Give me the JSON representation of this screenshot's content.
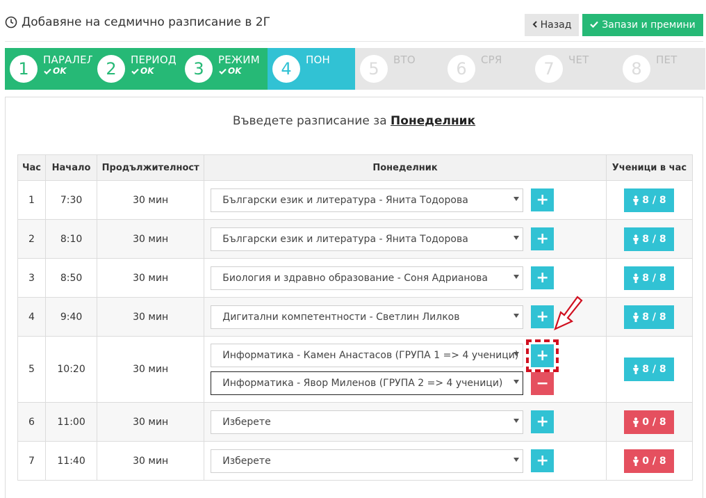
{
  "header": {
    "title": "Добавяне на седмично разписание в 2Г",
    "back_label": "Назад",
    "save_label": "Запази и премини"
  },
  "steps": [
    {
      "num": "1",
      "label": "ПАРАЛЕЛ",
      "status": "OK",
      "state": "done"
    },
    {
      "num": "2",
      "label": "ПЕРИОД",
      "status": "OK",
      "state": "done"
    },
    {
      "num": "3",
      "label": "РЕЖИМ",
      "status": "OK",
      "state": "done"
    },
    {
      "num": "4",
      "label": "ПОН",
      "status": "",
      "state": "active"
    },
    {
      "num": "5",
      "label": "ВТО",
      "status": "",
      "state": "todo"
    },
    {
      "num": "6",
      "label": "СРЯ",
      "status": "",
      "state": "todo"
    },
    {
      "num": "7",
      "label": "ЧЕТ",
      "status": "",
      "state": "todo"
    },
    {
      "num": "8",
      "label": "ПЕТ",
      "status": "",
      "state": "todo"
    }
  ],
  "prompt": {
    "text": "Въведете разписание за ",
    "day": "Понеделник"
  },
  "table": {
    "headers": [
      "Час",
      "Начало",
      "Продължителност",
      "Понеделник",
      "Ученици в час"
    ],
    "rows": [
      {
        "hour": "1",
        "start": "7:30",
        "duration": "30 мин",
        "selects": [
          "Български език и литература - Янита Тодорова"
        ],
        "students": "8 / 8",
        "status": "ok"
      },
      {
        "hour": "2",
        "start": "8:10",
        "duration": "30 мин",
        "selects": [
          "Български език и литература - Янита Тодорова"
        ],
        "students": "8 / 8",
        "status": "ok"
      },
      {
        "hour": "3",
        "start": "8:50",
        "duration": "30 мин",
        "selects": [
          "Биология и здравно образование - Соня Адрианова"
        ],
        "students": "8 / 8",
        "status": "ok"
      },
      {
        "hour": "4",
        "start": "9:40",
        "duration": "30 мин",
        "selects": [
          "Дигитални компетентности - Светлин Лилков"
        ],
        "students": "8 / 8",
        "status": "ok"
      },
      {
        "hour": "5",
        "start": "10:20",
        "duration": "30 мин",
        "selects": [
          "Информатика - Камен Анастасов (ГРУПА 1 => 4 ученици)",
          "Информатика - Явор Миленов (ГРУПА 2 => 4 ученици)"
        ],
        "students": "8 / 8",
        "status": "ok"
      },
      {
        "hour": "6",
        "start": "11:00",
        "duration": "30 мин",
        "selects": [
          "Изберете"
        ],
        "students": "0 / 8",
        "status": "bad"
      },
      {
        "hour": "7",
        "start": "11:40",
        "duration": "30 мин",
        "selects": [
          "Изберете"
        ],
        "students": "0 / 8",
        "status": "bad"
      }
    ]
  },
  "colors": {
    "green": "#26b976",
    "cyan": "#31c2d4",
    "red": "#e5505f",
    "highlight": "#d01020"
  }
}
